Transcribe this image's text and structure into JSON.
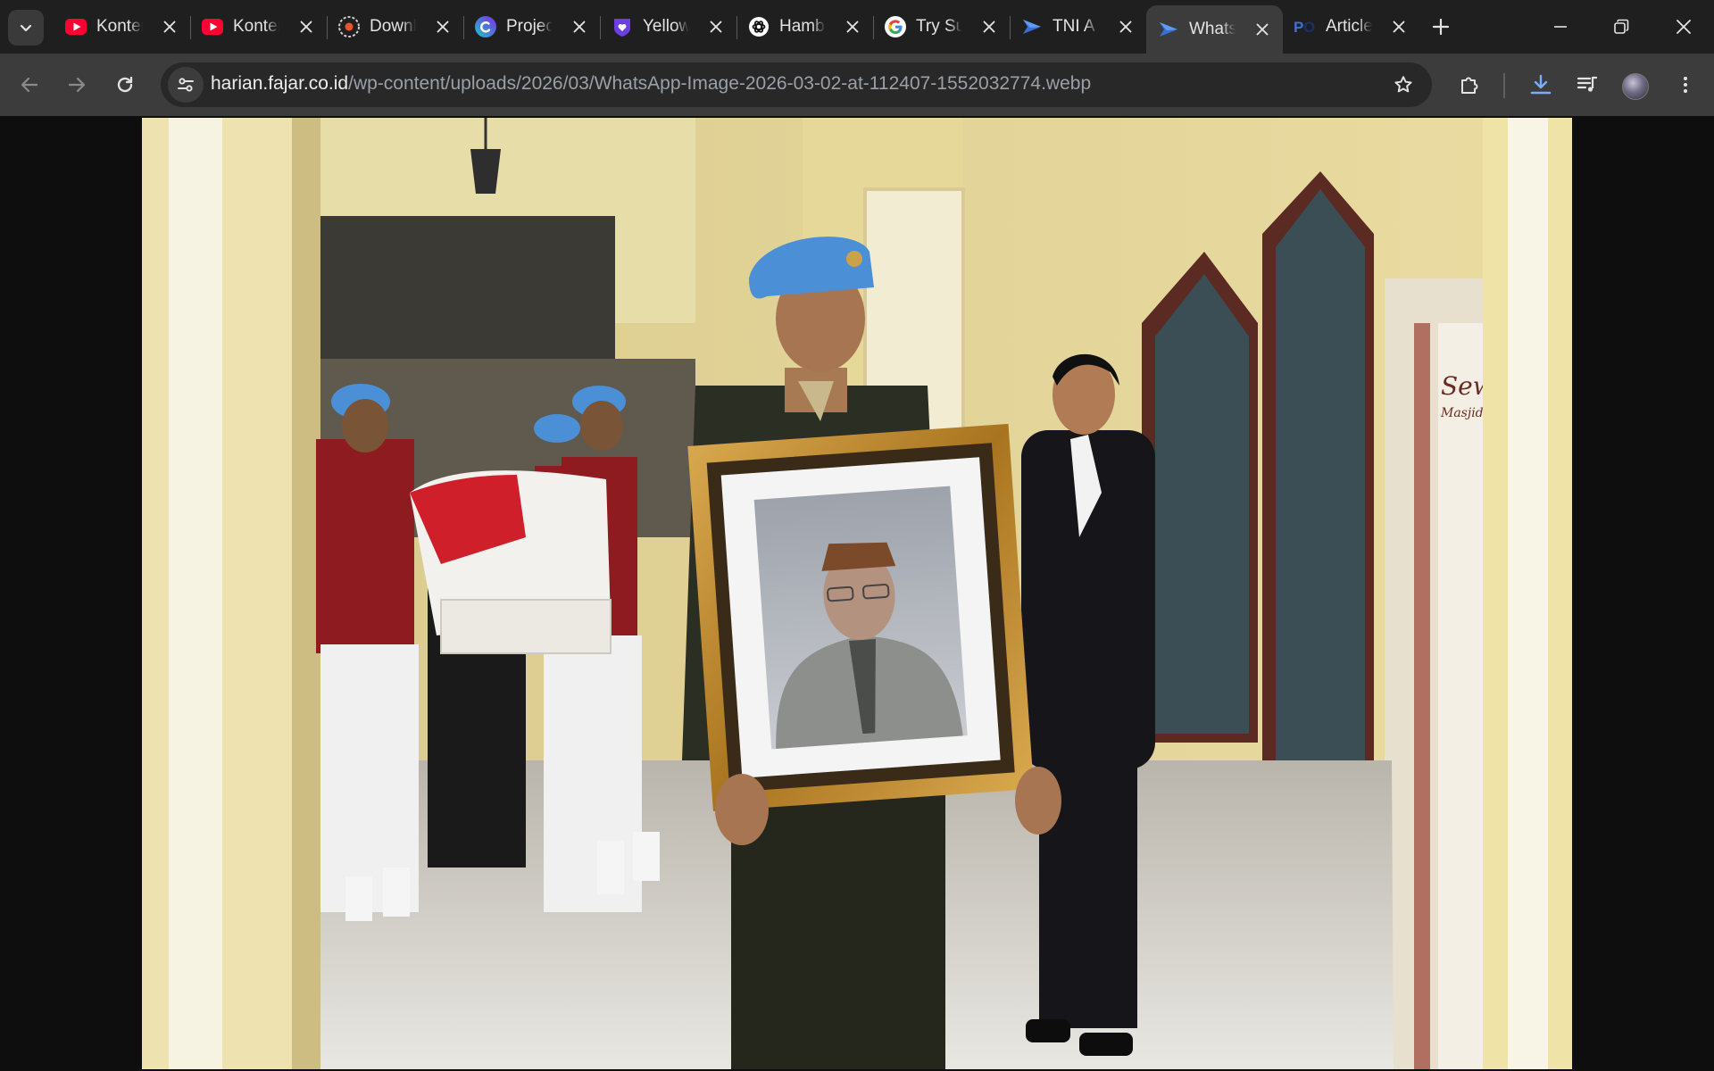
{
  "tabs": [
    {
      "title": "Konten",
      "favicon": "youtube-icon",
      "active": false
    },
    {
      "title": "Konten",
      "favicon": "youtube-icon",
      "active": false
    },
    {
      "title": "Downloads",
      "favicon": "download-ring-icon",
      "active": false
    },
    {
      "title": "Project",
      "favicon": "canva-icon",
      "active": false
    },
    {
      "title": "Yellow",
      "favicon": "heart-shield-icon",
      "active": false
    },
    {
      "title": "Hamb",
      "favicon": "openai-icon",
      "active": false
    },
    {
      "title": "Try Su",
      "favicon": "google-icon",
      "active": false
    },
    {
      "title": "TNI A",
      "favicon": "gemini-arrow-icon",
      "active": false
    },
    {
      "title": "Whats",
      "favicon": "gemini-arrow-icon",
      "active": true
    },
    {
      "title": "Article",
      "favicon": "po-icon",
      "active": false
    }
  ],
  "address": {
    "host": "harian.fajar.co.id",
    "path": "/wp-content/uploads/2026/03/WhatsApp-Image-2026-03-02-at-112407-1552032774.webp"
  },
  "colors": {
    "tabstrip": "#1f1f1f",
    "toolbar": "#3c3c3c",
    "download_accent": "#7cacf8",
    "beret": "#4b8fd6"
  },
  "photo": {
    "banner_text": "Sewa",
    "banner_subtext": "Masjid r"
  }
}
